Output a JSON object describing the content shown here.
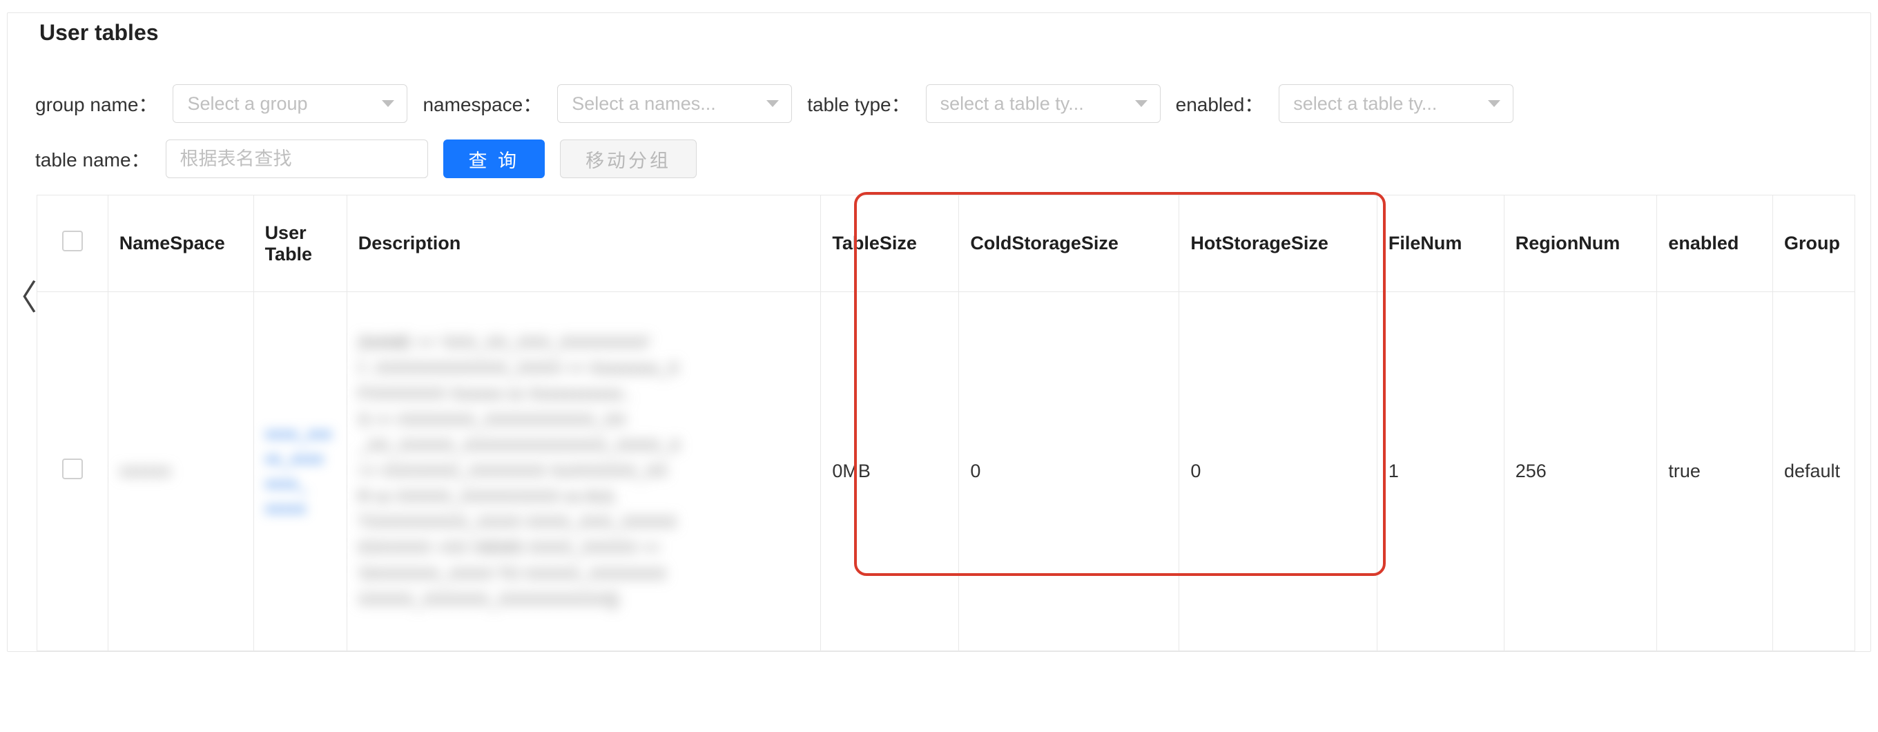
{
  "page": {
    "title": "User tables"
  },
  "filters": {
    "group_label": "group name：",
    "group_placeholder": "Select a group",
    "namespace_label": "namespace：",
    "namespace_placeholder": "Select a names...",
    "tabletype_label": "table type：",
    "tabletype_placeholder": "select a table ty...",
    "enabled_label": "enabled：",
    "enabled_placeholder": "select a table ty...",
    "tablename_label": "table name：",
    "tablename_placeholder": "根据表名查找",
    "search_btn": "查 询",
    "move_btn": "移动分组"
  },
  "table": {
    "headers": {
      "namespace": "NameSpace",
      "user_table": "User Table",
      "description": "Description",
      "table_size": "TableSize",
      "cold_storage_size": "ColdStorageSize",
      "hot_storage_size": "HotStorageSize",
      "file_num": "FileNum",
      "region_num": "RegionNum",
      "enabled": "enabled",
      "group": "Group"
    },
    "row": {
      "namespace_blur": "xxxxxx",
      "user_table_blur": "xxxx_xxx\nxx_xxxx\nxxxx_\nxxxxx",
      "description_blur": "{NAME => 'XXX_XX_XXX_XXXXXXXX'\nI', XXXXXXXXXXXX_XXXX => Xxxxxxxx_X\nFXXXXXXX Xxxxxx xx Xxxxxxxxxxx..\nS => XXXXXXX_XXXXXXXXXX_XX\n_XX_XXXXX_XXXXXXXXXXXXX_XXXX_X\n=> XXXXXXX_XXXXXXX  XxXXXXXX_XX\nR xx XXXXX_XXXXXXXXX xx        AUL\nTXXXXXXXXX_XXXX XXXX_XXX_XXXXX\nIOXXXXX =XX  XIEMS XXXX_XXXXX == \n'DXXXXXX_XXXX TO XXXXX_XXXXXXX\nXXXXX_XXXXXX_XXXXXXXXXX]}",
      "table_size": "0MB",
      "cold_storage_size": "0",
      "hot_storage_size": "0",
      "file_num": "1",
      "region_num": "256",
      "enabled": "true",
      "group": "default"
    }
  },
  "collapse_glyph": "〈"
}
